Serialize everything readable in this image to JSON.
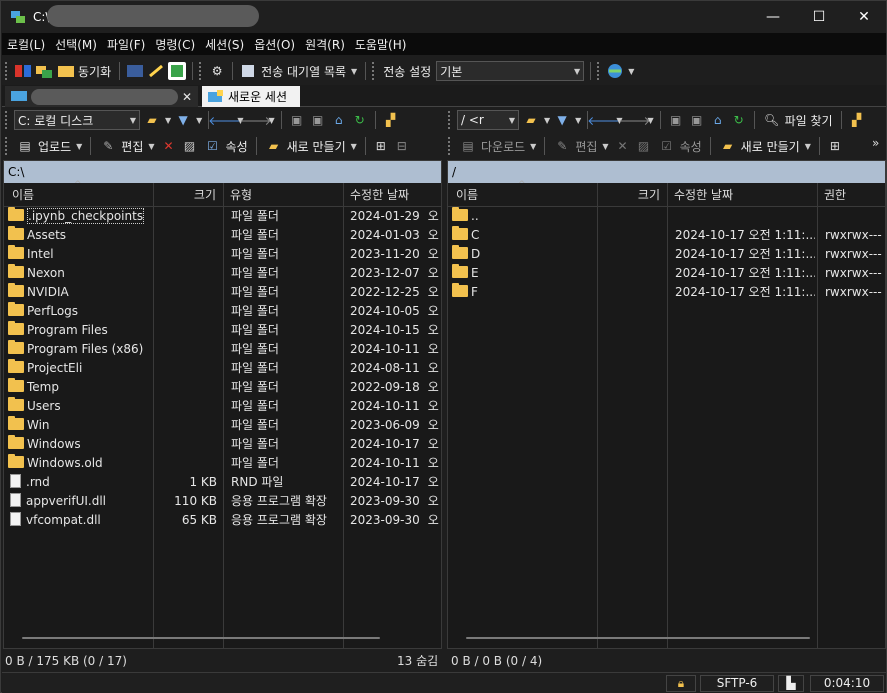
{
  "window": {
    "title": "C:\\",
    "minimize": "—",
    "maximize": "☐",
    "close": "✕"
  },
  "menu": [
    "로컬(L)",
    "선택(M)",
    "파일(F)",
    "명령(C)",
    "세션(S)",
    "옵션(O)",
    "원격(R)",
    "도움말(H)"
  ],
  "toolbar": {
    "sync_label": "동기화",
    "queue_label": "전송 대기열 목록",
    "transfer_settings_label": "전송 설정",
    "transfer_preset": "기본"
  },
  "tabs": {
    "new_session": "새로운 세션"
  },
  "local_toolbar": {
    "drive": "C: 로컬 디스크",
    "upload": "업로드",
    "edit": "편집",
    "properties": "속성",
    "new": "새로 만들기"
  },
  "remote_toolbar": {
    "path": "/ <r",
    "find_files": "파일 찾기",
    "download": "다운로드",
    "edit": "편집",
    "properties": "속성",
    "new": "새로 만들기"
  },
  "local": {
    "path": "C:\\",
    "columns": [
      "이름",
      "크기",
      "유형",
      "수정한 날짜"
    ],
    "rows": [
      {
        "name": ".ipynb_checkpoints",
        "size": "",
        "type": "파일 폴더",
        "date": "2024-01-29",
        "time": "오",
        "kind": "folder"
      },
      {
        "name": "Assets",
        "size": "",
        "type": "파일 폴더",
        "date": "2024-01-03",
        "time": "오",
        "kind": "folder"
      },
      {
        "name": "Intel",
        "size": "",
        "type": "파일 폴더",
        "date": "2023-11-20",
        "time": "오",
        "kind": "folder"
      },
      {
        "name": "Nexon",
        "size": "",
        "type": "파일 폴더",
        "date": "2023-12-07",
        "time": "오",
        "kind": "folder"
      },
      {
        "name": "NVIDIA",
        "size": "",
        "type": "파일 폴더",
        "date": "2022-12-25",
        "time": "오",
        "kind": "folder"
      },
      {
        "name": "PerfLogs",
        "size": "",
        "type": "파일 폴더",
        "date": "2024-10-05",
        "time": "오",
        "kind": "folder"
      },
      {
        "name": "Program Files",
        "size": "",
        "type": "파일 폴더",
        "date": "2024-10-15",
        "time": "오",
        "kind": "folder"
      },
      {
        "name": "Program Files (x86)",
        "size": "",
        "type": "파일 폴더",
        "date": "2024-10-11",
        "time": "오",
        "kind": "folder"
      },
      {
        "name": "ProjectEli",
        "size": "",
        "type": "파일 폴더",
        "date": "2024-08-11",
        "time": "오",
        "kind": "folder"
      },
      {
        "name": "Temp",
        "size": "",
        "type": "파일 폴더",
        "date": "2022-09-18",
        "time": "오",
        "kind": "folder"
      },
      {
        "name": "Users",
        "size": "",
        "type": "파일 폴더",
        "date": "2024-10-11",
        "time": "오",
        "kind": "folder"
      },
      {
        "name": "Win",
        "size": "",
        "type": "파일 폴더",
        "date": "2023-06-09",
        "time": "오",
        "kind": "folder"
      },
      {
        "name": "Windows",
        "size": "",
        "type": "파일 폴더",
        "date": "2024-10-17",
        "time": "오",
        "kind": "folder"
      },
      {
        "name": "Windows.old",
        "size": "",
        "type": "파일 폴더",
        "date": "2024-10-11",
        "time": "오",
        "kind": "folder"
      },
      {
        "name": ".rnd",
        "size": "1 KB",
        "type": "RND 파일",
        "date": "2024-10-17",
        "time": "오",
        "kind": "file"
      },
      {
        "name": "appverifUI.dll",
        "size": "110 KB",
        "type": "응용 프로그램 확장",
        "date": "2023-09-30",
        "time": "오",
        "kind": "file"
      },
      {
        "name": "vfcompat.dll",
        "size": "65 KB",
        "type": "응용 프로그램 확장",
        "date": "2023-09-30",
        "time": "오",
        "kind": "file"
      }
    ],
    "status_left": "0 B / 175 KB (0 / 17)",
    "status_right": "13 숨김"
  },
  "remote": {
    "path": "/",
    "columns": [
      "이름",
      "크기",
      "수정한 날짜",
      "권한"
    ],
    "rows": [
      {
        "name": "..",
        "size": "",
        "date": "",
        "perm": "",
        "kind": "up"
      },
      {
        "name": "C",
        "size": "",
        "date": "2024-10-17 오전 1:11:...",
        "perm": "rwxrwx---",
        "kind": "folder"
      },
      {
        "name": "D",
        "size": "",
        "date": "2024-10-17 오전 1:11:...",
        "perm": "rwxrwx---",
        "kind": "folder"
      },
      {
        "name": "E",
        "size": "",
        "date": "2024-10-17 오전 1:11:...",
        "perm": "rwxrwx---",
        "kind": "folder"
      },
      {
        "name": "F",
        "size": "",
        "date": "2024-10-17 오전 1:11:...",
        "perm": "rwxrwx---",
        "kind": "folder"
      }
    ],
    "status_left": "0 B / 0 B (0 / 4)"
  },
  "bottom_status": {
    "protocol": "SFTP-6",
    "elapsed": "0:04:10"
  }
}
